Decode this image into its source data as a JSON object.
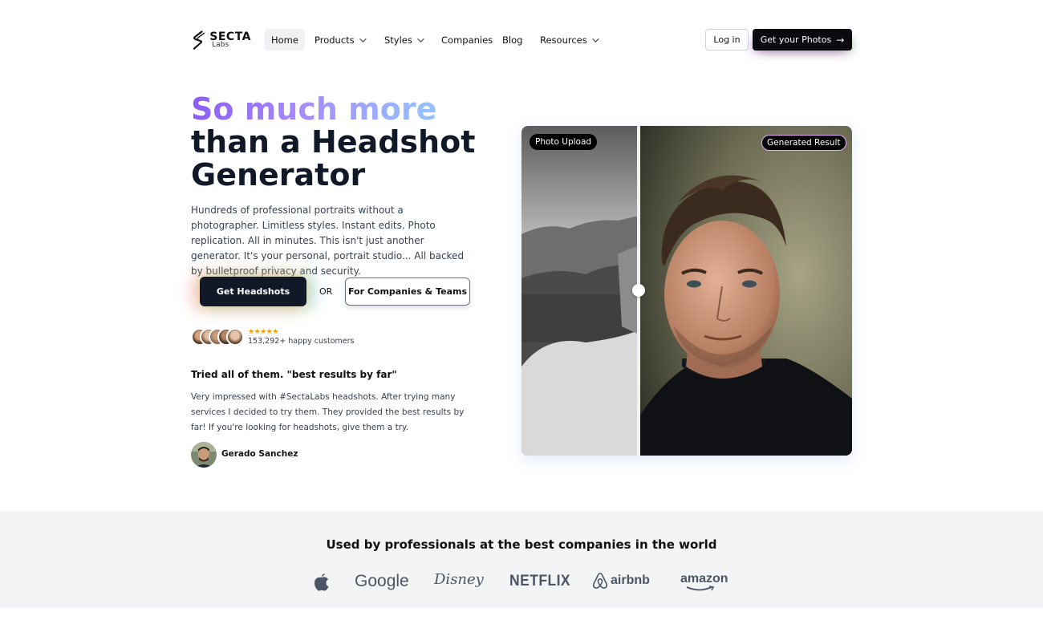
{
  "nav": {
    "logo_main": "SECTA",
    "logo_sub": "Labs",
    "items": [
      {
        "label": "Home",
        "dropdown": false
      },
      {
        "label": "Products",
        "dropdown": true
      },
      {
        "label": "Styles",
        "dropdown": true
      },
      {
        "label": "Companies",
        "dropdown": false
      },
      {
        "label": "Blog",
        "dropdown": false
      },
      {
        "label": "Resources",
        "dropdown": true
      }
    ],
    "login_label": "Log in",
    "cta_label": "Get your Photos"
  },
  "hero": {
    "headline_gradient": "So much more",
    "headline_line2": "than a Headshot",
    "headline_line3": "Generator",
    "description": "Hundreds of professional portraits without a photographer. Limitless styles. Instant edits. Photo replication. All in minutes. This isn't just another generator. It's your personal, portrait studio... All backed by bulletproof privacy and security.",
    "primary_cta": "Get Headshots",
    "or_text": "OR",
    "secondary_cta": "For Companies & Teams",
    "rating_stars": "★★★★★",
    "customers_text": "153,292+ happy customers"
  },
  "testimonial": {
    "title": "Tried all of them. \"best results by far\"",
    "body": "Very impressed with #SectaLabs headshots. After trying many services I decided to try them. They provided the best results by far! If you're looking for headshots, give them a try.",
    "author": "Gerado Sanchez"
  },
  "compare": {
    "left_label": "Photo Upload",
    "right_label": "Generated Result"
  },
  "logos": {
    "title": "Used by professionals at the best companies in the world",
    "companies": [
      "Apple",
      "Google",
      "Disney",
      "NETFLIX",
      "airbnb",
      "amazon"
    ]
  },
  "colors": {
    "headline_gradient_start": "#8b5cf6",
    "headline_gradient_end": "#93c5fd",
    "primary_button": "#111827",
    "strip_background": "#f3f4f6"
  }
}
